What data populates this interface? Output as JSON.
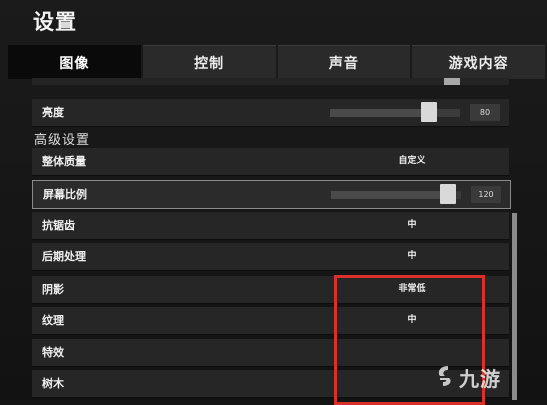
{
  "header": {
    "title": "设置"
  },
  "tabs": [
    {
      "label": "图像",
      "active": true
    },
    {
      "label": "控制",
      "active": false
    },
    {
      "label": "声音",
      "active": false
    },
    {
      "label": "游戏内容",
      "active": false
    }
  ],
  "brightness": {
    "label": "亮度",
    "value": "80",
    "level": 0.8
  },
  "advanced": {
    "title": "高级设置",
    "quality": {
      "label": "整体质量",
      "value": "自定义"
    },
    "scale": {
      "label": "屏幕比例",
      "value": "120",
      "level": 0.96
    },
    "antialias": {
      "label": "抗锯齿",
      "value": "中"
    },
    "postprocess": {
      "label": "后期处理",
      "value": "中"
    },
    "shadow": {
      "label": "阴影",
      "value": "非常低"
    },
    "texture": {
      "label": "纹理",
      "value": "中"
    },
    "effects": {
      "label": "特效",
      "value": ""
    },
    "trees": {
      "label": "树木",
      "value": ""
    }
  },
  "watermark": {
    "text": "九游"
  },
  "colors": {
    "highlight_box": "#d9302c",
    "thumb": "#d9d9d9"
  }
}
